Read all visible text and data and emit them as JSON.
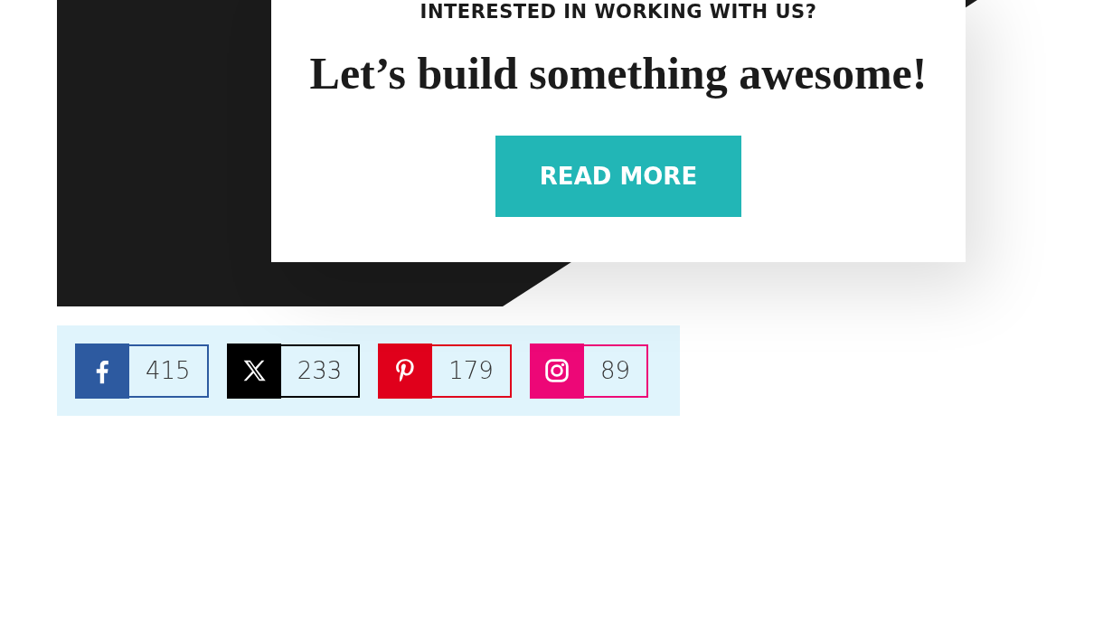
{
  "hero": {
    "eyebrow": "INTERESTED IN WORKING WITH US?",
    "headline": "Let’s build something awesome!",
    "button": "READ MORE"
  },
  "shares": [
    {
      "kind": "facebook",
      "color": "#2d5aa0",
      "count": "415"
    },
    {
      "kind": "x",
      "color": "#000000",
      "count": "233"
    },
    {
      "kind": "pinterest",
      "color": "#e0001b",
      "count": "179"
    },
    {
      "kind": "instagram",
      "color": "#ed0777",
      "count": "89"
    }
  ]
}
